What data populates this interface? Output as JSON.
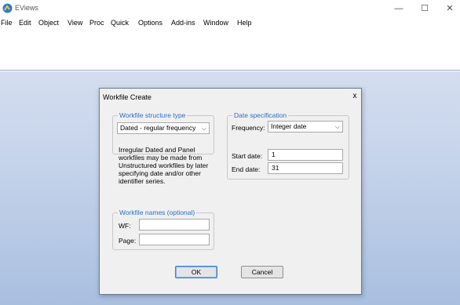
{
  "window": {
    "title": "EViews",
    "minimize": "—",
    "maximize": "☐",
    "close": "✕"
  },
  "menu": [
    "File",
    "Edit",
    "Object",
    "View",
    "Proc",
    "Quick",
    "Options",
    "Add-ins",
    "Window",
    "Help"
  ],
  "dialog": {
    "title": "Workfile Create",
    "close": "x",
    "structure": {
      "label": "Workfile structure type",
      "selected": "Dated - regular frequency",
      "note": "Irregular Dated and Panel workfiles may be made from Unstructured workfiles by later specifying date and/or other identifier series."
    },
    "date_spec": {
      "label": "Date specification",
      "frequency_label": "Frequency:",
      "frequency_value": "Integer date",
      "start_label": "Start date:",
      "start_value": "1",
      "end_label": "End date:",
      "end_value": "31"
    },
    "names": {
      "label": "Workfile names (optional)",
      "wf_label": "WF:",
      "wf_value": "",
      "page_label": "Page:",
      "page_value": ""
    },
    "ok_label": "OK",
    "cancel_label": "Cancel"
  },
  "colors": {
    "accent": "#2b6fc7",
    "workspace": "#c5d3ea"
  },
  "icons": {
    "app": "eviews-logo-icon",
    "dropdown": "chevron-down-icon"
  }
}
